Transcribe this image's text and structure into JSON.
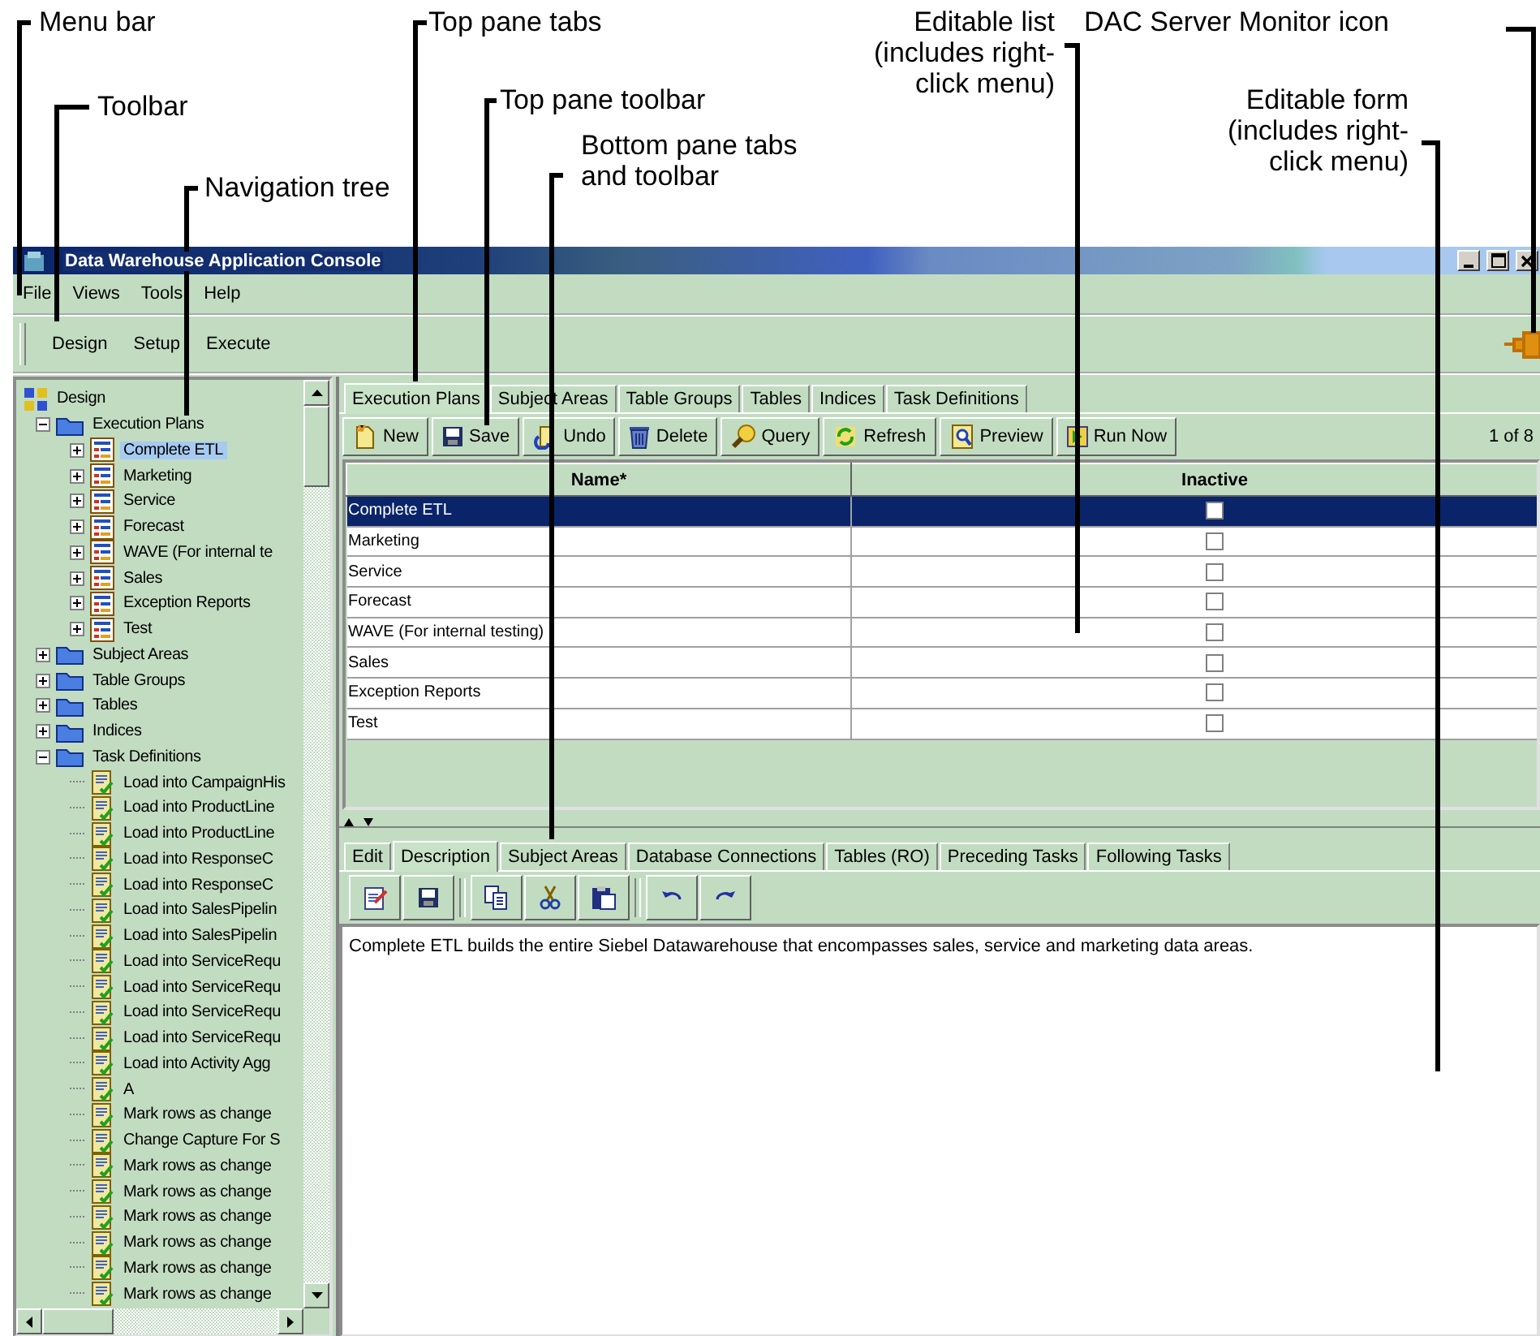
{
  "callouts": [
    {
      "text": "Menu bar"
    },
    {
      "text": "Toolbar"
    },
    {
      "text": "Navigation tree"
    },
    {
      "text": "Top pane tabs"
    },
    {
      "text": "Top pane toolbar"
    },
    {
      "text": "Bottom pane tabs and toolbar"
    },
    {
      "text": "Editable list (includes right-click menu)"
    },
    {
      "text": "DAC Server Monitor icon"
    },
    {
      "text": "Editable form (includes right-click menu)"
    }
  ],
  "window": {
    "title": "Data Warehouse Application Console"
  },
  "menu": [
    "File",
    "Views",
    "Tools",
    "Help"
  ],
  "toolbar": [
    "Design",
    "Setup",
    "Execute"
  ],
  "nav_tree": [
    {
      "label": "Design",
      "kind": "root",
      "selected": false,
      "children": [
        {
          "label": "Execution Plans",
          "kind": "folder",
          "expanded": true,
          "selected": false,
          "children": [
            {
              "label": "Complete ETL",
              "kind": "plan",
              "expanded": false,
              "selected": true
            },
            {
              "label": "Marketing",
              "kind": "plan",
              "expanded": false,
              "selected": false
            },
            {
              "label": "Service",
              "kind": "plan",
              "expanded": false,
              "selected": false
            },
            {
              "label": "Forecast",
              "kind": "plan",
              "expanded": false,
              "selected": false
            },
            {
              "label": "WAVE (For internal te",
              "kind": "plan",
              "expanded": false,
              "selected": false
            },
            {
              "label": "Sales",
              "kind": "plan",
              "expanded": false,
              "selected": false
            },
            {
              "label": "Exception Reports",
              "kind": "plan",
              "expanded": false,
              "selected": false
            },
            {
              "label": "Test",
              "kind": "plan",
              "expanded": false,
              "selected": false
            }
          ]
        },
        {
          "label": "Subject Areas",
          "kind": "folder",
          "expanded": false,
          "selected": false
        },
        {
          "label": "Table Groups",
          "kind": "folder",
          "expanded": false,
          "selected": false
        },
        {
          "label": "Tables",
          "kind": "folder",
          "expanded": false,
          "selected": false
        },
        {
          "label": "Indices",
          "kind": "folder",
          "expanded": false,
          "selected": false
        },
        {
          "label": "Task Definitions",
          "kind": "folder",
          "expanded": true,
          "selected": false,
          "children": [
            {
              "label": "Load into CampaignHis",
              "kind": "task",
              "selected": false
            },
            {
              "label": "Load into ProductLine",
              "kind": "task",
              "selected": false
            },
            {
              "label": "Load into ProductLine",
              "kind": "task",
              "selected": false
            },
            {
              "label": "Load into ResponseC",
              "kind": "task",
              "selected": false
            },
            {
              "label": "Load into ResponseC",
              "kind": "task",
              "selected": false
            },
            {
              "label": "Load into SalesPipelin",
              "kind": "task",
              "selected": false
            },
            {
              "label": "Load into SalesPipelin",
              "kind": "task",
              "selected": false
            },
            {
              "label": "Load into ServiceRequ",
              "kind": "task",
              "selected": false
            },
            {
              "label": "Load into ServiceRequ",
              "kind": "task",
              "selected": false
            },
            {
              "label": "Load into ServiceRequ",
              "kind": "task",
              "selected": false
            },
            {
              "label": "Load into ServiceRequ",
              "kind": "task",
              "selected": false
            },
            {
              "label": "Load into Activity Agg",
              "kind": "task",
              "selected": false
            },
            {
              "label": "A",
              "kind": "task",
              "selected": false
            },
            {
              "label": "Mark rows as change",
              "kind": "task",
              "selected": false
            },
            {
              "label": "Change Capture For S",
              "kind": "task",
              "selected": false
            },
            {
              "label": "Mark rows as change",
              "kind": "task",
              "selected": false
            },
            {
              "label": "Mark rows as change",
              "kind": "task",
              "selected": false
            },
            {
              "label": "Mark rows as change",
              "kind": "task",
              "selected": false
            },
            {
              "label": "Mark rows as change",
              "kind": "task",
              "selected": false
            },
            {
              "label": "Mark rows as change",
              "kind": "task",
              "selected": false
            },
            {
              "label": "Mark rows as change",
              "kind": "task",
              "selected": false
            }
          ]
        }
      ]
    }
  ],
  "top_tabs": [
    {
      "label": "Execution Plans",
      "selected": true
    },
    {
      "label": "Subject Areas",
      "selected": false
    },
    {
      "label": "Table Groups",
      "selected": false
    },
    {
      "label": "Tables",
      "selected": false
    },
    {
      "label": "Indices",
      "selected": false
    },
    {
      "label": "Task Definitions",
      "selected": false
    }
  ],
  "top_toolbar": [
    {
      "label": "New",
      "kind": "new"
    },
    {
      "label": "Save",
      "kind": "save"
    },
    {
      "label": "Undo",
      "kind": "undo"
    },
    {
      "label": "Delete",
      "kind": "delete"
    },
    {
      "label": "Query",
      "kind": "query"
    },
    {
      "label": "Refresh",
      "kind": "refresh"
    },
    {
      "label": "Preview",
      "kind": "preview"
    },
    {
      "label": "Run Now",
      "kind": "run"
    }
  ],
  "record_count": "1 of 8",
  "table": {
    "columns": [
      "Name*",
      "Inactive"
    ],
    "rows": [
      {
        "name": "Complete ETL",
        "inactive": false,
        "selected": true
      },
      {
        "name": "Marketing",
        "inactive": false,
        "selected": false
      },
      {
        "name": "Service",
        "inactive": false,
        "selected": false
      },
      {
        "name": "Forecast",
        "inactive": false,
        "selected": false
      },
      {
        "name": "WAVE (For internal testing)",
        "inactive": false,
        "selected": false
      },
      {
        "name": "Sales",
        "inactive": false,
        "selected": false
      },
      {
        "name": "Exception Reports",
        "inactive": false,
        "selected": false
      },
      {
        "name": "Test",
        "inactive": false,
        "selected": false
      }
    ]
  },
  "bottom_tabs": [
    {
      "label": "Edit",
      "selected": false
    },
    {
      "label": "Description",
      "selected": true
    },
    {
      "label": "Subject Areas",
      "selected": false
    },
    {
      "label": "Database Connections",
      "selected": false
    },
    {
      "label": "Tables (RO)",
      "selected": false
    },
    {
      "label": "Preceding Tasks",
      "selected": false
    },
    {
      "label": "Following Tasks",
      "selected": false
    }
  ],
  "bottom_toolbar": [
    {
      "kind": "edit"
    },
    {
      "kind": "save"
    },
    {
      "kind": "separator"
    },
    {
      "kind": "copy"
    },
    {
      "kind": "cut"
    },
    {
      "kind": "paste"
    },
    {
      "kind": "separator"
    },
    {
      "kind": "undo"
    },
    {
      "kind": "redo"
    }
  ],
  "description": "Complete ETL builds the entire Siebel Datawarehouse that encompasses sales, service and marketing data areas."
}
